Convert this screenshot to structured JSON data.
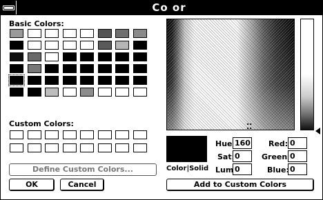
{
  "window": {
    "title": "Co or"
  },
  "labels": {
    "basic_colors": "Basic Colors:",
    "custom_colors": "Custom Colors:",
    "color_solid": "Color|Solid",
    "hue": "Hue:",
    "sat": "Sat:",
    "lum": "Lum:",
    "red": "Red:",
    "green": "Green:",
    "blue": "Blue:"
  },
  "values": {
    "hue": "160",
    "sat": "0",
    "lum": "0",
    "red": "0",
    "green": "0",
    "blue": "0"
  },
  "buttons": {
    "define_custom": "Define Custom Colors...",
    "ok": "OK",
    "cancel": "Cancel",
    "add_custom": "Add to Custom Colors"
  },
  "basic_colors": [
    [
      "#9a9a9a",
      "#ffffff",
      "#ffffff",
      "#ffffff",
      "#ffffff",
      "#555555",
      "#6f6f6f",
      "#8a8a8a"
    ],
    [
      "#000000",
      "#ffffff",
      "#ffffff",
      "#ffffff",
      "#ffffff",
      "#5a5a5a",
      "#b5b5b5",
      "#000000"
    ],
    [
      "#101010",
      "#6a6a6a",
      "#ffffff",
      "#000000",
      "#000000",
      "#000000",
      "#000000",
      "#000000"
    ],
    [
      "#000000",
      "#777777",
      "#000000",
      "#000000",
      "#000000",
      "#000000",
      "#000000",
      "#000000"
    ],
    [
      "#000000",
      "#000000",
      "#000000",
      "#000000",
      "#000000",
      "#000000",
      "#000000",
      "#000000"
    ],
    [
      "#000000",
      "#000000",
      "#bdbdbd",
      "#ffffff",
      "#8c8c8c",
      "#ffffff",
      "#ffffff",
      "#ffffff"
    ]
  ],
  "selected_swatch": [
    4,
    0
  ]
}
